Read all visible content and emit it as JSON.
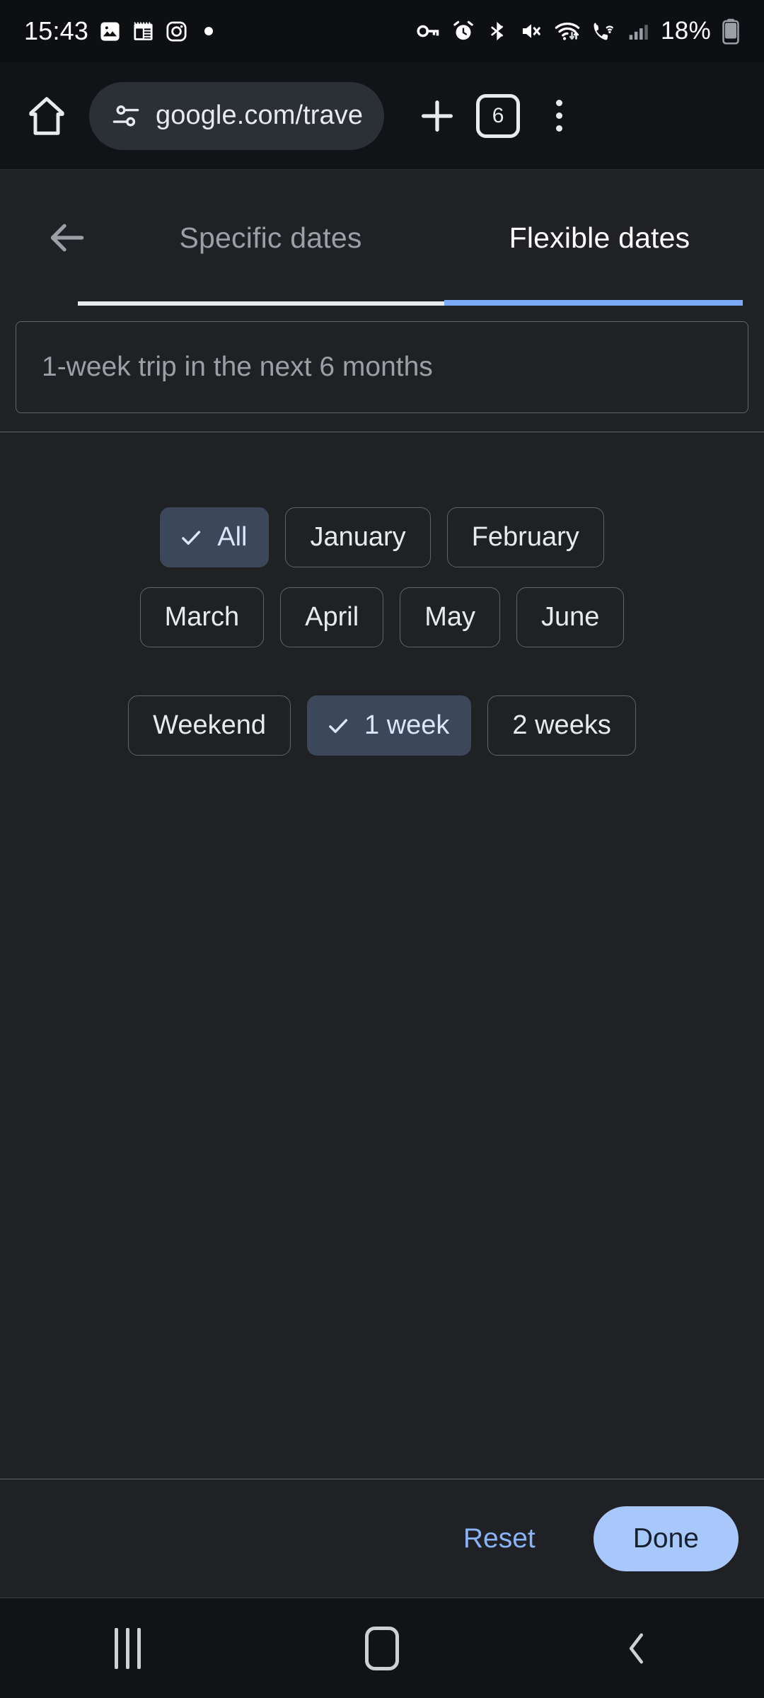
{
  "status_bar": {
    "time": "15:43",
    "battery": "18%",
    "left_icons": [
      "photos-icon",
      "calendar-icon",
      "instagram-icon",
      "dot-indicator-icon"
    ],
    "right_icons": [
      "vpn-key-icon",
      "alarm-icon",
      "bluetooth-icon",
      "mute-icon",
      "wifi-icon",
      "wifi-calling-icon",
      "signal-bars-icon",
      "battery-icon"
    ]
  },
  "browser": {
    "home_icon": "home-icon",
    "site_settings_icon": "tune-icon",
    "url": "google.com/trave",
    "new_tab_icon": "plus-icon",
    "tab_count": "6",
    "menu_icon": "more-vert-icon"
  },
  "page": {
    "back_icon": "arrow-back-icon",
    "tabs": [
      {
        "label": "Specific dates",
        "active": false
      },
      {
        "label": "Flexible dates",
        "active": true
      }
    ],
    "summary_field": {
      "value": "1-week trip in the next 6 months",
      "placeholder": "1-week trip in the next 6 months"
    },
    "month_rows": [
      [
        {
          "label": "All",
          "selected": true
        },
        {
          "label": "January",
          "selected": false
        },
        {
          "label": "February",
          "selected": false
        }
      ],
      [
        {
          "label": "March",
          "selected": false
        },
        {
          "label": "April",
          "selected": false
        },
        {
          "label": "May",
          "selected": false
        },
        {
          "label": "June",
          "selected": false
        }
      ]
    ],
    "duration_row": [
      {
        "label": "Weekend",
        "selected": false
      },
      {
        "label": "1 week",
        "selected": true
      },
      {
        "label": "2 weeks",
        "selected": false
      }
    ],
    "footer": {
      "reset_label": "Reset",
      "done_label": "Done"
    }
  },
  "nav_bar": {
    "recents_icon": "recents-icon",
    "home_icon": "home-square-icon",
    "back_icon": "back-chevron-icon"
  },
  "colors": {
    "chrome_bg": "#121316",
    "page_bg": "#202124",
    "accent_blue": "#8ab4f8",
    "done_bg": "#a8c7fa",
    "chip_selected_bg": "#3c4859",
    "tab_indicator": "#7cacf8",
    "muted_text": "#9aa0a6"
  }
}
